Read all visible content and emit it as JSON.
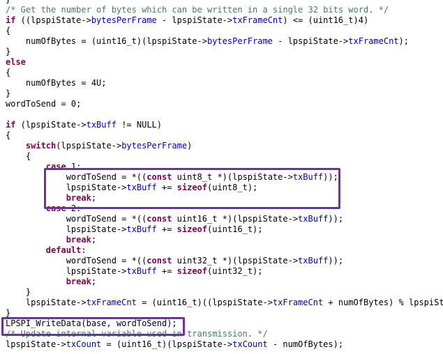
{
  "editor": {
    "language": "c",
    "colors": {
      "background": "#ffffff",
      "keyword": "#7f0055",
      "field": "#0000c0",
      "comment": "#3f7f5f",
      "plain": "#000000",
      "highlight_box": "#7030a0"
    },
    "lines": [
      {
        "tokens": [
          {
            "t": "}",
            "c": "plain"
          }
        ]
      },
      {
        "tokens": [
          {
            "t": "/* Get the number of bytes which can be written in a single 32 bits word. */",
            "c": "comment"
          }
        ]
      },
      {
        "tokens": [
          {
            "t": "if",
            "c": "kw"
          },
          {
            "t": " ((lpspiState->",
            "c": "plain"
          },
          {
            "t": "bytesPerFrame",
            "c": "field"
          },
          {
            "t": " - lpspiState->",
            "c": "plain"
          },
          {
            "t": "txFrameCnt",
            "c": "field"
          },
          {
            "t": ") <= (uint16_t)4)",
            "c": "plain"
          }
        ]
      },
      {
        "tokens": [
          {
            "t": "{",
            "c": "plain"
          }
        ]
      },
      {
        "tokens": [
          {
            "t": "    numOfBytes = (uint16_t)(lpspiState->",
            "c": "plain"
          },
          {
            "t": "bytesPerFrame",
            "c": "field"
          },
          {
            "t": " - lpspiState->",
            "c": "plain"
          },
          {
            "t": "txFrameCnt",
            "c": "field"
          },
          {
            "t": ");",
            "c": "plain"
          }
        ]
      },
      {
        "tokens": [
          {
            "t": "}",
            "c": "plain"
          }
        ]
      },
      {
        "tokens": [
          {
            "t": "else",
            "c": "kw"
          }
        ]
      },
      {
        "tokens": [
          {
            "t": "{",
            "c": "plain"
          }
        ]
      },
      {
        "tokens": [
          {
            "t": "    numOfBytes = 4U;",
            "c": "plain"
          }
        ]
      },
      {
        "tokens": [
          {
            "t": "}",
            "c": "plain"
          }
        ]
      },
      {
        "tokens": [
          {
            "t": "wordToSend = 0;",
            "c": "plain"
          }
        ]
      },
      {
        "tokens": [
          {
            "t": "",
            "c": "plain"
          }
        ]
      },
      {
        "tokens": [
          {
            "t": "if",
            "c": "kw"
          },
          {
            "t": " (lpspiState->",
            "c": "plain"
          },
          {
            "t": "txBuff",
            "c": "field"
          },
          {
            "t": " != NULL)",
            "c": "plain"
          }
        ]
      },
      {
        "tokens": [
          {
            "t": "{",
            "c": "plain"
          }
        ]
      },
      {
        "tokens": [
          {
            "t": "    ",
            "c": "plain"
          },
          {
            "t": "switch",
            "c": "kw"
          },
          {
            "t": "(lpspiState->",
            "c": "plain"
          },
          {
            "t": "bytesPerFrame",
            "c": "field"
          },
          {
            "t": ")",
            "c": "plain"
          }
        ]
      },
      {
        "tokens": [
          {
            "t": "    {",
            "c": "plain"
          }
        ]
      },
      {
        "tokens": [
          {
            "t": "        ",
            "c": "plain"
          },
          {
            "t": "case",
            "c": "kw"
          },
          {
            "t": " 1:",
            "c": "plain"
          }
        ]
      },
      {
        "tokens": [
          {
            "t": "            wordToSend = *((",
            "c": "plain"
          },
          {
            "t": "const",
            "c": "kw"
          },
          {
            "t": " uint8_t *)(lpspiState->",
            "c": "plain"
          },
          {
            "t": "txBuff",
            "c": "field"
          },
          {
            "t": "));",
            "c": "plain"
          }
        ]
      },
      {
        "tokens": [
          {
            "t": "            lpspiState->",
            "c": "plain"
          },
          {
            "t": "txBuff",
            "c": "field"
          },
          {
            "t": " += ",
            "c": "plain"
          },
          {
            "t": "sizeof",
            "c": "kw"
          },
          {
            "t": "(uint8_t);",
            "c": "plain"
          }
        ]
      },
      {
        "tokens": [
          {
            "t": "            ",
            "c": "plain"
          },
          {
            "t": "break",
            "c": "kw"
          },
          {
            "t": ";",
            "c": "plain"
          }
        ]
      },
      {
        "tokens": [
          {
            "t": "        ",
            "c": "plain"
          },
          {
            "t": "case",
            "c": "kw"
          },
          {
            "t": " 2:",
            "c": "plain"
          }
        ]
      },
      {
        "tokens": [
          {
            "t": "            wordToSend = *((",
            "c": "plain"
          },
          {
            "t": "const",
            "c": "kw"
          },
          {
            "t": " uint16_t *)(lpspiState->",
            "c": "plain"
          },
          {
            "t": "txBuff",
            "c": "field"
          },
          {
            "t": "));",
            "c": "plain"
          }
        ]
      },
      {
        "tokens": [
          {
            "t": "            lpspiState->",
            "c": "plain"
          },
          {
            "t": "txBuff",
            "c": "field"
          },
          {
            "t": " += ",
            "c": "plain"
          },
          {
            "t": "sizeof",
            "c": "kw"
          },
          {
            "t": "(uint16_t);",
            "c": "plain"
          }
        ]
      },
      {
        "tokens": [
          {
            "t": "            ",
            "c": "plain"
          },
          {
            "t": "break",
            "c": "kw"
          },
          {
            "t": ";",
            "c": "plain"
          }
        ]
      },
      {
        "tokens": [
          {
            "t": "        ",
            "c": "plain"
          },
          {
            "t": "default",
            "c": "kw"
          },
          {
            "t": ":",
            "c": "plain"
          }
        ]
      },
      {
        "tokens": [
          {
            "t": "            wordToSend = *((",
            "c": "plain"
          },
          {
            "t": "const",
            "c": "kw"
          },
          {
            "t": " uint32_t *)(lpspiState->",
            "c": "plain"
          },
          {
            "t": "txBuff",
            "c": "field"
          },
          {
            "t": "));",
            "c": "plain"
          }
        ]
      },
      {
        "tokens": [
          {
            "t": "            lpspiState->",
            "c": "plain"
          },
          {
            "t": "txBuff",
            "c": "field"
          },
          {
            "t": " += ",
            "c": "plain"
          },
          {
            "t": "sizeof",
            "c": "kw"
          },
          {
            "t": "(uint32_t);",
            "c": "plain"
          }
        ]
      },
      {
        "tokens": [
          {
            "t": "            ",
            "c": "plain"
          },
          {
            "t": "break",
            "c": "kw"
          },
          {
            "t": ";",
            "c": "plain"
          }
        ]
      },
      {
        "tokens": [
          {
            "t": "    }",
            "c": "plain"
          }
        ]
      },
      {
        "tokens": [
          {
            "t": "    lpspiState->",
            "c": "plain"
          },
          {
            "t": "txFrameCnt",
            "c": "field"
          },
          {
            "t": " = (uint16_t)((lpspiState->",
            "c": "plain"
          },
          {
            "t": "txFrameCnt",
            "c": "field"
          },
          {
            "t": " + numOfBytes) % lpspiState",
            "c": "plain"
          }
        ]
      },
      {
        "tokens": [
          {
            "t": "}",
            "c": "plain"
          }
        ]
      },
      {
        "tokens": [
          {
            "t": "LPSPI_WriteData(base, wordToSend);",
            "c": "plain"
          }
        ]
      },
      {
        "tokens": [
          {
            "t": "/* Update internal variable used in transmission. */",
            "c": "comment"
          }
        ]
      },
      {
        "tokens": [
          {
            "t": "lpspiState->",
            "c": "plain"
          },
          {
            "t": "txCount",
            "c": "field"
          },
          {
            "t": " = (uint16_t)(lpspiState->",
            "c": "plain"
          },
          {
            "t": "txCount",
            "c": "field"
          },
          {
            "t": " - numOfBytes);",
            "c": "plain"
          }
        ]
      }
    ]
  }
}
